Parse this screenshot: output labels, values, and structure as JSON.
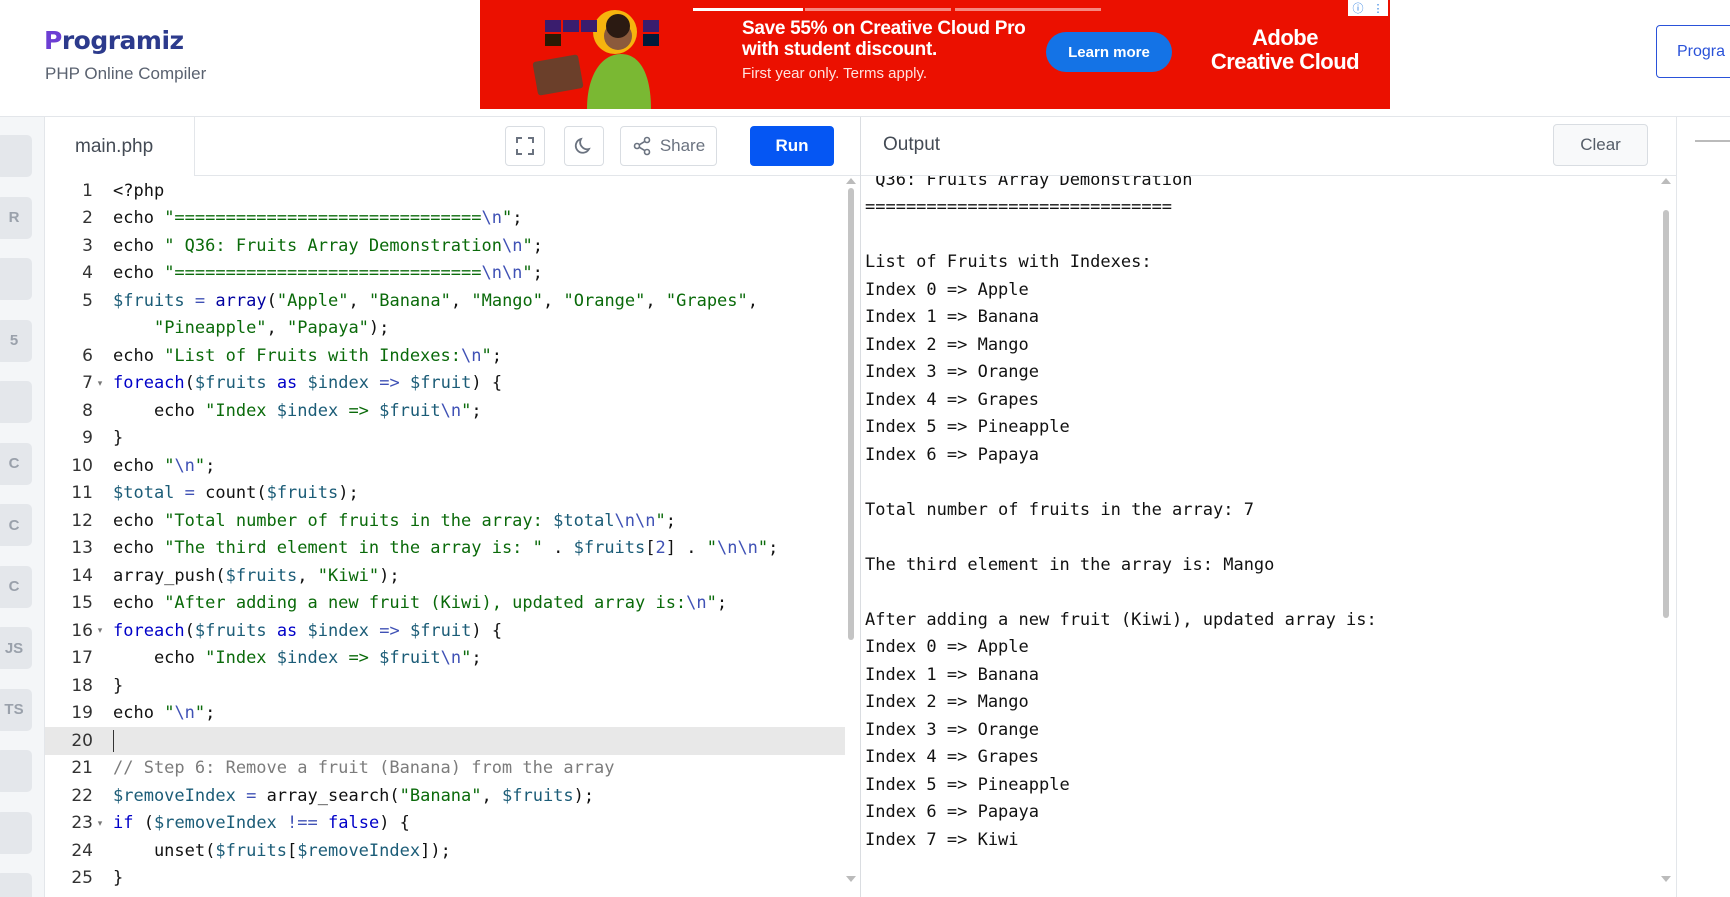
{
  "header": {
    "logo_text": "rogramiz",
    "logo_initial": "P",
    "subtitle": "PHP Online Compiler",
    "pro_button": "Progra"
  },
  "ad": {
    "headline_1": "Save 55% on Creative Cloud Pro",
    "headline_2": "with student discount.",
    "subline": "First year only. Terms apply.",
    "cta": "Learn more",
    "brand_1": "Adobe",
    "brand_2": "Creative Cloud",
    "app_badges": [
      "Ps",
      "Pr",
      "Ae",
      "Ai",
      "Id",
      "Lr"
    ],
    "info_icon": "info-icon",
    "colors": {
      "background": "#eb1000",
      "button": "#1473e6"
    }
  },
  "sidebar": {
    "languages": [
      {
        "name": "python-icon",
        "label": ""
      },
      {
        "name": "r-icon",
        "label": "R"
      },
      {
        "name": "sql-icon",
        "label": ""
      },
      {
        "name": "html5-icon",
        "label": "5"
      },
      {
        "name": "java-icon",
        "label": ""
      },
      {
        "name": "c-icon",
        "label": "C"
      },
      {
        "name": "cpp-icon",
        "label": "C"
      },
      {
        "name": "csharp-icon",
        "label": "C"
      },
      {
        "name": "js-icon",
        "label": "JS"
      },
      {
        "name": "ts-icon",
        "label": "TS"
      },
      {
        "name": "go-icon",
        "label": ""
      },
      {
        "name": "php-icon",
        "label": ""
      },
      {
        "name": "swift-icon",
        "label": ""
      }
    ]
  },
  "editor": {
    "file_name": "main.php",
    "share_label": "Share",
    "run_label": "Run",
    "active_line": 20
  },
  "output": {
    "title": "Output",
    "clear_label": "Clear",
    "lines": [
      " Q36: Fruits Array Demonstration",
      "==============================",
      "",
      "List of Fruits with Indexes:",
      "Index 0 => Apple",
      "Index 1 => Banana",
      "Index 2 => Mango",
      "Index 3 => Orange",
      "Index 4 => Grapes",
      "Index 5 => Pineapple",
      "Index 6 => Papaya",
      "",
      "Total number of fruits in the array: 7",
      "",
      "The third element in the array is: Mango",
      "",
      "After adding a new fruit (Kiwi), updated array is:",
      "Index 0 => Apple",
      "Index 1 => Banana",
      "Index 2 => Mango",
      "Index 3 => Orange",
      "Index 4 => Grapes",
      "Index 5 => Pineapple",
      "Index 6 => Papaya",
      "Index 7 => Kiwi"
    ]
  },
  "code_lines": [
    {
      "n": "1",
      "fold": false,
      "tokens": [
        [
          "t",
          "<?php"
        ]
      ]
    },
    {
      "n": "2",
      "fold": false,
      "tokens": [
        [
          "t",
          "echo "
        ],
        [
          "str",
          "\"=============================="
        ],
        [
          "esc",
          "\\n"
        ],
        [
          "str",
          "\""
        ],
        [
          "t",
          ";"
        ]
      ]
    },
    {
      "n": "3",
      "fold": false,
      "tokens": [
        [
          "t",
          "echo "
        ],
        [
          "str",
          "\" Q36: Fruits Array Demonstration"
        ],
        [
          "esc",
          "\\n"
        ],
        [
          "str",
          "\""
        ],
        [
          "t",
          ";"
        ]
      ]
    },
    {
      "n": "4",
      "fold": false,
      "tokens": [
        [
          "t",
          "echo "
        ],
        [
          "str",
          "\"=============================="
        ],
        [
          "esc",
          "\\n\\n"
        ],
        [
          "str",
          "\""
        ],
        [
          "t",
          ";"
        ]
      ]
    },
    {
      "n": "5",
      "fold": false,
      "tokens": [
        [
          "var",
          "$fruits"
        ],
        [
          "t",
          " "
        ],
        [
          "esc",
          "="
        ],
        [
          "t",
          " "
        ],
        [
          "fn",
          "array"
        ],
        [
          "t",
          "("
        ],
        [
          "str",
          "\"Apple\""
        ],
        [
          "t",
          ", "
        ],
        [
          "str",
          "\"Banana\""
        ],
        [
          "t",
          ", "
        ],
        [
          "str",
          "\"Mango\""
        ],
        [
          "t",
          ", "
        ],
        [
          "str",
          "\"Orange\""
        ],
        [
          "t",
          ", "
        ],
        [
          "str",
          "\"Grapes\""
        ],
        [
          "t",
          ","
        ]
      ]
    },
    {
      "n": "",
      "fold": false,
      "tokens": [
        [
          "t",
          "    "
        ],
        [
          "str",
          "\"Pineapple\""
        ],
        [
          "t",
          ", "
        ],
        [
          "str",
          "\"Papaya\""
        ],
        [
          "t",
          ");"
        ]
      ]
    },
    {
      "n": "6",
      "fold": false,
      "tokens": [
        [
          "t",
          "echo "
        ],
        [
          "str",
          "\"List of Fruits with Indexes:"
        ],
        [
          "esc",
          "\\n"
        ],
        [
          "str",
          "\""
        ],
        [
          "t",
          ";"
        ]
      ]
    },
    {
      "n": "7",
      "fold": true,
      "tokens": [
        [
          "kw",
          "foreach"
        ],
        [
          "t",
          "("
        ],
        [
          "var",
          "$fruits"
        ],
        [
          "t",
          " "
        ],
        [
          "kw",
          "as"
        ],
        [
          "t",
          " "
        ],
        [
          "var",
          "$index"
        ],
        [
          "t",
          " "
        ],
        [
          "esc",
          "=>"
        ],
        [
          "t",
          " "
        ],
        [
          "var",
          "$fruit"
        ],
        [
          "t",
          ") {"
        ]
      ]
    },
    {
      "n": "8",
      "fold": false,
      "tokens": [
        [
          "t",
          "    echo "
        ],
        [
          "str",
          "\"Index "
        ],
        [
          "var",
          "$index"
        ],
        [
          "str",
          " => "
        ],
        [
          "var",
          "$fruit"
        ],
        [
          "esc",
          "\\n"
        ],
        [
          "str",
          "\""
        ],
        [
          "t",
          ";"
        ]
      ]
    },
    {
      "n": "9",
      "fold": false,
      "tokens": [
        [
          "t",
          "}"
        ]
      ]
    },
    {
      "n": "10",
      "fold": false,
      "tokens": [
        [
          "t",
          "echo "
        ],
        [
          "str",
          "\""
        ],
        [
          "esc",
          "\\n"
        ],
        [
          "str",
          "\""
        ],
        [
          "t",
          ";"
        ]
      ]
    },
    {
      "n": "11",
      "fold": false,
      "tokens": [
        [
          "var",
          "$total"
        ],
        [
          "t",
          " "
        ],
        [
          "esc",
          "="
        ],
        [
          "t",
          " count("
        ],
        [
          "var",
          "$fruits"
        ],
        [
          "t",
          ");"
        ]
      ]
    },
    {
      "n": "12",
      "fold": false,
      "tokens": [
        [
          "t",
          "echo "
        ],
        [
          "str",
          "\"Total number of fruits in the array: "
        ],
        [
          "var",
          "$total"
        ],
        [
          "esc",
          "\\n\\n"
        ],
        [
          "str",
          "\""
        ],
        [
          "t",
          ";"
        ]
      ]
    },
    {
      "n": "13",
      "fold": false,
      "tokens": [
        [
          "t",
          "echo "
        ],
        [
          "str",
          "\"The third element in the array is: \""
        ],
        [
          "t",
          " . "
        ],
        [
          "var",
          "$fruits"
        ],
        [
          "t",
          "["
        ],
        [
          "esc",
          "2"
        ],
        [
          "t",
          "] . "
        ],
        [
          "str",
          "\""
        ],
        [
          "esc",
          "\\n\\n"
        ],
        [
          "str",
          "\""
        ],
        [
          "t",
          ";"
        ]
      ]
    },
    {
      "n": "14",
      "fold": false,
      "tokens": [
        [
          "t",
          "array_push("
        ],
        [
          "var",
          "$fruits"
        ],
        [
          "t",
          ", "
        ],
        [
          "str",
          "\"Kiwi\""
        ],
        [
          "t",
          ");"
        ]
      ]
    },
    {
      "n": "15",
      "fold": false,
      "tokens": [
        [
          "t",
          "echo "
        ],
        [
          "str",
          "\"After adding a new fruit (Kiwi), updated array is:"
        ],
        [
          "esc",
          "\\n"
        ],
        [
          "str",
          "\""
        ],
        [
          "t",
          ";"
        ]
      ]
    },
    {
      "n": "16",
      "fold": true,
      "tokens": [
        [
          "kw",
          "foreach"
        ],
        [
          "t",
          "("
        ],
        [
          "var",
          "$fruits"
        ],
        [
          "t",
          " "
        ],
        [
          "kw",
          "as"
        ],
        [
          "t",
          " "
        ],
        [
          "var",
          "$index"
        ],
        [
          "t",
          " "
        ],
        [
          "esc",
          "=>"
        ],
        [
          "t",
          " "
        ],
        [
          "var",
          "$fruit"
        ],
        [
          "t",
          ") {"
        ]
      ]
    },
    {
      "n": "17",
      "fold": false,
      "tokens": [
        [
          "t",
          "    echo "
        ],
        [
          "str",
          "\"Index "
        ],
        [
          "var",
          "$index"
        ],
        [
          "str",
          " => "
        ],
        [
          "var",
          "$fruit"
        ],
        [
          "esc",
          "\\n"
        ],
        [
          "str",
          "\""
        ],
        [
          "t",
          ";"
        ]
      ]
    },
    {
      "n": "18",
      "fold": false,
      "tokens": [
        [
          "t",
          "}"
        ]
      ]
    },
    {
      "n": "19",
      "fold": false,
      "tokens": [
        [
          "t",
          "echo "
        ],
        [
          "str",
          "\""
        ],
        [
          "esc",
          "\\n"
        ],
        [
          "str",
          "\""
        ],
        [
          "t",
          ";"
        ]
      ]
    },
    {
      "n": "20",
      "fold": false,
      "tokens": []
    },
    {
      "n": "21",
      "fold": false,
      "tokens": [
        [
          "cm",
          "// Step 6: Remove a fruit (Banana) from the array"
        ]
      ]
    },
    {
      "n": "22",
      "fold": false,
      "tokens": [
        [
          "var",
          "$removeIndex"
        ],
        [
          "t",
          " "
        ],
        [
          "esc",
          "="
        ],
        [
          "t",
          " array_search("
        ],
        [
          "str",
          "\"Banana\""
        ],
        [
          "t",
          ", "
        ],
        [
          "var",
          "$fruits"
        ],
        [
          "t",
          ");"
        ]
      ]
    },
    {
      "n": "23",
      "fold": true,
      "tokens": [
        [
          "kw",
          "if"
        ],
        [
          "t",
          " ("
        ],
        [
          "var",
          "$removeIndex"
        ],
        [
          "t",
          " "
        ],
        [
          "esc",
          "!=="
        ],
        [
          "t",
          " "
        ],
        [
          "kw",
          "false"
        ],
        [
          "t",
          ") {"
        ]
      ]
    },
    {
      "n": "24",
      "fold": false,
      "tokens": [
        [
          "t",
          "    unset("
        ],
        [
          "var",
          "$fruits"
        ],
        [
          "t",
          "["
        ],
        [
          "var",
          "$removeIndex"
        ],
        [
          "t",
          "]);"
        ]
      ]
    },
    {
      "n": "25",
      "fold": false,
      "tokens": [
        [
          "t",
          "}"
        ]
      ]
    }
  ]
}
